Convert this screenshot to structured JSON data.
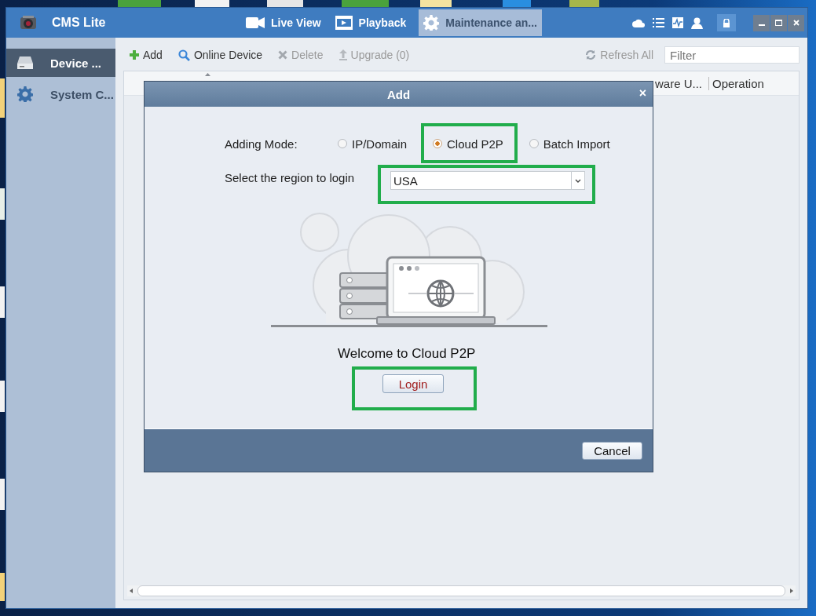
{
  "app": {
    "title": "CMS Lite"
  },
  "nav_tabs": [
    {
      "label": "Live View",
      "selected": false
    },
    {
      "label": "Playback",
      "selected": false
    },
    {
      "label": "Maintenance an...",
      "selected": true
    }
  ],
  "sidebar": {
    "items": [
      {
        "label": "Device ...",
        "selected": true
      },
      {
        "label": "System C...",
        "selected": false
      }
    ]
  },
  "toolbar": {
    "buttons": [
      {
        "label": "Add",
        "disabled": false
      },
      {
        "label": "Online Device",
        "disabled": false
      },
      {
        "label": "Delete",
        "disabled": true
      },
      {
        "label": "Upgrade (0)",
        "disabled": true
      }
    ],
    "refresh": {
      "label": "Refresh All",
      "disabled": true
    },
    "filter": {
      "placeholder": "Filter"
    }
  },
  "table": {
    "columns": [
      "ware U...",
      "Operation"
    ]
  },
  "dialog": {
    "title": "Add",
    "close": "×",
    "mode_label": "Adding Mode:",
    "modes": [
      {
        "label": "IP/Domain",
        "selected": false
      },
      {
        "label": "Cloud P2P",
        "selected": true
      },
      {
        "label": "Batch Import",
        "selected": false
      }
    ],
    "region_label": "Select the region to login",
    "region": {
      "value": "USA"
    },
    "welcome": "Welcome to Cloud P2P",
    "login": "Login",
    "cancel": "Cancel"
  }
}
